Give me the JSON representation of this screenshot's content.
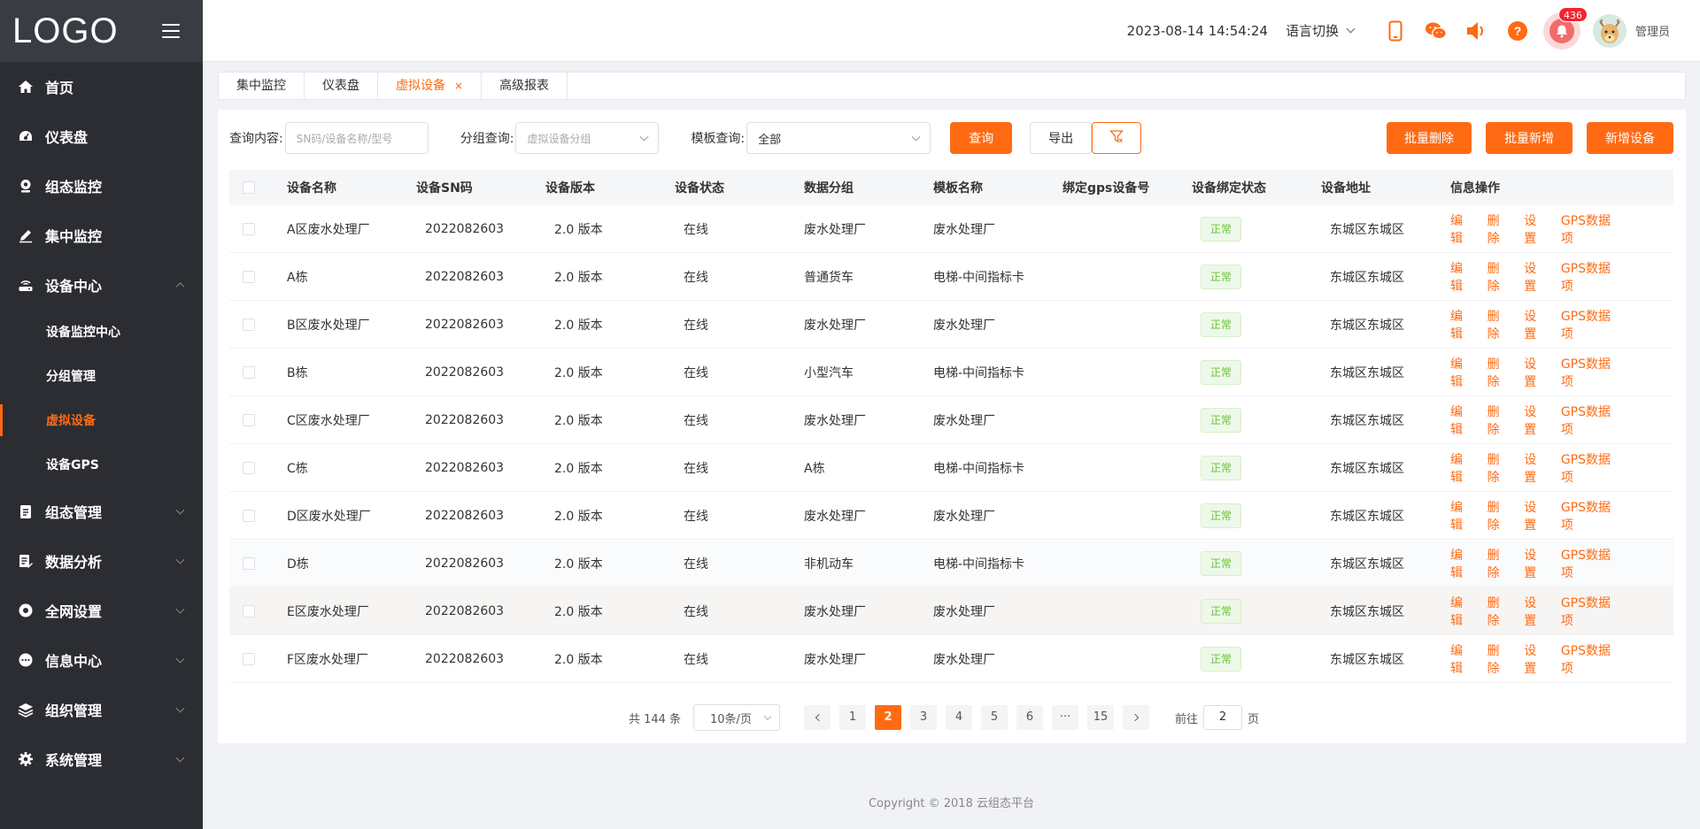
{
  "sidebar": {
    "logo": "LOGO",
    "items": [
      {
        "label": "首页",
        "icon": "home-icon"
      },
      {
        "label": "仪表盘",
        "icon": "dashboard-icon"
      },
      {
        "label": "组态监控",
        "icon": "webcam-icon"
      },
      {
        "label": "集中监控",
        "icon": "pen-icon"
      },
      {
        "label": "设备中心",
        "icon": "router-icon"
      },
      {
        "label": "组态管理",
        "icon": "clipboard-icon"
      },
      {
        "label": "数据分析",
        "icon": "report-icon"
      },
      {
        "label": "全网设置",
        "icon": "circle-icon"
      },
      {
        "label": "信息中心",
        "icon": "chat-icon"
      },
      {
        "label": "组织管理",
        "icon": "layers-icon"
      },
      {
        "label": "系统管理",
        "icon": "gear-icon"
      }
    ],
    "submenu": [
      "设备监控中心",
      "分组管理",
      "虚拟设备",
      "设备GPS"
    ],
    "active_sub": "虚拟设备"
  },
  "header": {
    "datetime": "2023-08-14 14:54:24",
    "language": "语言切换",
    "badge_count": "436",
    "admin": "管理员",
    "icons": [
      "mobile-icon",
      "wechat-icon",
      "speaker-icon",
      "help-icon",
      "bell-icon"
    ]
  },
  "tabs": [
    {
      "label": "集中监控"
    },
    {
      "label": "仪表盘"
    },
    {
      "label": "虚拟设备",
      "close": "×"
    },
    {
      "label": "高级报表"
    }
  ],
  "filters": {
    "query_label": "查询内容:",
    "query_placeholder": "SN码/设备名称/型号",
    "group_label": "分组查询:",
    "group_placeholder": "虚拟设备分组",
    "template_label": "模板查询:",
    "template_value": "全部",
    "search_btn": "查询",
    "export_btn": "导出",
    "batch_delete": "批量删除",
    "batch_add": "批量新增",
    "add_device": "新增设备"
  },
  "table": {
    "headers": [
      "设备名称",
      "设备SN码",
      "设备版本",
      "设备状态",
      "数据分组",
      "模板名称",
      "绑定gps设备号",
      "设备绑定状态",
      "设备地址",
      "信息操作"
    ],
    "ops": [
      "编辑",
      "删除",
      "设置",
      "GPS数据项"
    ],
    "rows": [
      {
        "name": "A区废水处理厂",
        "sn": "2022082603",
        "ver": "2.0 版本",
        "status": "在线",
        "group": "废水处理厂",
        "tpl": "废水处理厂",
        "gps": "",
        "bind": "正常",
        "addr": "东城区东城区"
      },
      {
        "name": "A栋",
        "sn": "2022082603",
        "ver": "2.0 版本",
        "status": "在线",
        "group": "普通货车",
        "tpl": "电梯-中间指标卡",
        "gps": "",
        "bind": "正常",
        "addr": "东城区东城区"
      },
      {
        "name": "B区废水处理厂",
        "sn": "2022082603",
        "ver": "2.0 版本",
        "status": "在线",
        "group": "废水处理厂",
        "tpl": "废水处理厂",
        "gps": "",
        "bind": "正常",
        "addr": "东城区东城区"
      },
      {
        "name": "B栋",
        "sn": "2022082603",
        "ver": "2.0 版本",
        "status": "在线",
        "group": "小型汽车",
        "tpl": "电梯-中间指标卡",
        "gps": "",
        "bind": "正常",
        "addr": "东城区东城区"
      },
      {
        "name": "C区废水处理厂",
        "sn": "2022082603",
        "ver": "2.0 版本",
        "status": "在线",
        "group": "废水处理厂",
        "tpl": "废水处理厂",
        "gps": "",
        "bind": "正常",
        "addr": "东城区东城区"
      },
      {
        "name": "C栋",
        "sn": "2022082603",
        "ver": "2.0 版本",
        "status": "在线",
        "group": "A栋",
        "tpl": "电梯-中间指标卡",
        "gps": "",
        "bind": "正常",
        "addr": "东城区东城区"
      },
      {
        "name": "D区废水处理厂",
        "sn": "2022082603",
        "ver": "2.0 版本",
        "status": "在线",
        "group": "废水处理厂",
        "tpl": "废水处理厂",
        "gps": "",
        "bind": "正常",
        "addr": "东城区东城区"
      },
      {
        "name": "D栋",
        "sn": "2022082603",
        "ver": "2.0 版本",
        "status": "在线",
        "group": "非机动车",
        "tpl": "电梯-中间指标卡",
        "gps": "",
        "bind": "正常",
        "addr": "东城区东城区"
      },
      {
        "name": "E区废水处理厂",
        "sn": "2022082603",
        "ver": "2.0 版本",
        "status": "在线",
        "group": "废水处理厂",
        "tpl": "废水处理厂",
        "gps": "",
        "bind": "正常",
        "addr": "东城区东城区"
      },
      {
        "name": "F区废水处理厂",
        "sn": "2022082603",
        "ver": "2.0 版本",
        "status": "在线",
        "group": "废水处理厂",
        "tpl": "废水处理厂",
        "gps": "",
        "bind": "正常",
        "addr": "东城区东城区"
      }
    ]
  },
  "pagination": {
    "total": "共 144 条",
    "page_size": "10条/页",
    "pages": [
      "1",
      "2",
      "3",
      "4",
      "5",
      "6",
      "···",
      "15"
    ],
    "current": "2",
    "goto_label": "前往",
    "goto_value": "2",
    "goto_suffix": "页"
  },
  "footer": "Copyright © 2018 云组态平台",
  "colors": {
    "accent": "#ff6a13",
    "sidebar": "#2b2d33",
    "status_ok": "#67c23a"
  }
}
